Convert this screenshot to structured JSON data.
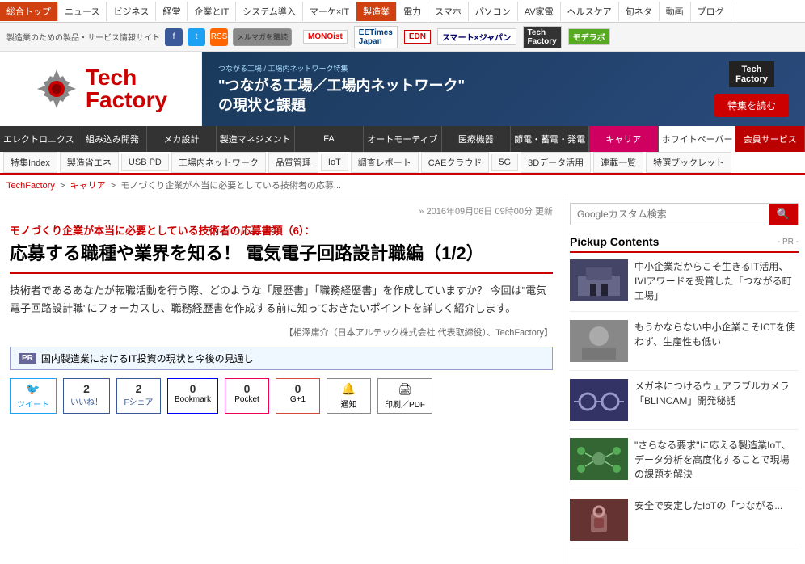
{
  "top_nav": {
    "items": [
      {
        "label": "総合トップ",
        "active": true
      },
      {
        "label": "ニュース",
        "active": false
      },
      {
        "label": "ビジネス",
        "active": false
      },
      {
        "label": "経堂",
        "active": false
      },
      {
        "label": "企業とIT",
        "active": false
      },
      {
        "label": "システム導入",
        "active": false
      },
      {
        "label": "マーケ×IT",
        "active": false
      },
      {
        "label": "製造業",
        "active": true,
        "highlight": true
      },
      {
        "label": "電力",
        "active": false
      },
      {
        "label": "スマホ",
        "active": false
      },
      {
        "label": "パソコン",
        "active": false
      },
      {
        "label": "AV家電",
        "active": false
      },
      {
        "label": "ヘルスケア",
        "active": false
      },
      {
        "label": "旬ネタ",
        "active": false
      },
      {
        "label": "動画",
        "active": false
      },
      {
        "label": "ブログ",
        "active": false
      }
    ]
  },
  "brand_bar": {
    "site_description": "製造業のための製品・サービス情報サイト",
    "mail_label": "メルマガを購読",
    "partners": [
      "MONOist",
      "EETimes Japan",
      "EDN",
      "スマート×ジャパン",
      "Tech Factory",
      "モデラボ"
    ]
  },
  "logo": {
    "tech": "Tech",
    "factory": "Factory"
  },
  "banner": {
    "text": "\"つながる工場／工場内ネットワーク\"\nの現状と課題",
    "button": "特集を読む",
    "tf_logo": "Tech\nFactory"
  },
  "cat_nav": {
    "items": [
      {
        "label": "エレクトロニクス",
        "class": ""
      },
      {
        "label": "組み込み開発",
        "class": ""
      },
      {
        "label": "メカ設計",
        "class": ""
      },
      {
        "label": "製造マネジメント",
        "class": ""
      },
      {
        "label": "FA",
        "class": ""
      },
      {
        "label": "オートモーティブ",
        "class": ""
      },
      {
        "label": "医療機器",
        "class": ""
      },
      {
        "label": "節電・蓄電・発電",
        "class": ""
      },
      {
        "label": "キャリア",
        "class": "career"
      },
      {
        "label": "ホワイトペーパー",
        "class": "white-paper"
      },
      {
        "label": "会員サービス",
        "class": "member"
      }
    ]
  },
  "sub_nav": {
    "items": [
      "特集Index",
      "製造省エネ",
      "USB PD",
      "工場内ネットワーク",
      "品質管理",
      "IoT",
      "調査レポート",
      "CAEクラウド",
      "5G",
      "3Dデータ活用",
      "連載一覧",
      "特選ブックレット"
    ]
  },
  "breadcrumb": {
    "items": [
      "TechFactory",
      "キャリア",
      "モノづくり企業が本当に必要としている技術者の応募..."
    ]
  },
  "search": {
    "placeholder": "Googleカスタム検索"
  },
  "article": {
    "date": "» 2016年09月06日 09時00分 更新",
    "series": "モノづくり企業が本当に必要としている技術者の応募書類（6）：",
    "title": "応募する職種や業界を知る！ 電気電子回路設計職編（1/2）",
    "body1": "技術者であるあなたが転職活動を行う際、どのような「履歴書」「職務経歴書」を作成していますか？ 今回は\"電気電子回路設計職\"にフォーカスし、職務経歴書を作成する前に知っておきたいポイントを詳しく紹介します。",
    "author": "【相澤庸介（日本アルテック株式会社 代表取締役）、TechFactory】",
    "pr_text": "国内製造業におけるIT投資の現状と今後の見通し"
  },
  "share": {
    "twitter_count": "",
    "twitter_label": "ツイート",
    "facebook_count": "2",
    "facebook_label": "いいね！",
    "facebook_share_label": "Fシェア",
    "facebook_share_count": "2",
    "bookmark_count": "0",
    "bookmark_label": "Bookmark",
    "pocket_count": "0",
    "pocket_label": "Pocket",
    "gplus_count": "0",
    "gplus_label": "G+1",
    "notify_count": "",
    "notify_label": "通知",
    "print_label": "印刷／PDF"
  },
  "pickup": {
    "title": "Pickup Contents",
    "pr_label": "- PR -",
    "items": [
      {
        "text": "中小企業だからこそ生きるIT活用、IVIアワードを受賞した「つながる町工場」",
        "thumb_class": "thumb-factory"
      },
      {
        "text": "もうかならない中小企業こそICTを使わず、生産性も低い",
        "thumb_class": "thumb-office"
      },
      {
        "text": "メガネにつけるウェアラブルカメラ「BLINCAM」開発秘話",
        "thumb_class": "thumb-glasses"
      },
      {
        "text": "\"さらなる要求\"に応える製造業IoT、データ分析を高度化することで現場の課題を解決",
        "thumb_class": "thumb-iot"
      },
      {
        "text": "安全で安定したIoTの「つながる...",
        "thumb_class": "thumb-secure"
      }
    ]
  }
}
